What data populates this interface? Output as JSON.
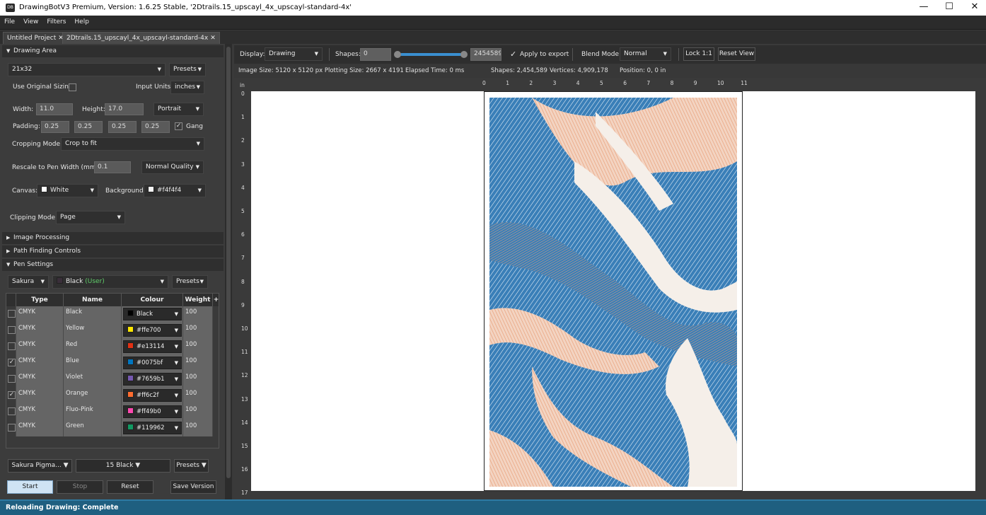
{
  "window": {
    "title": "DrawingBotV3 Premium, Version: 1.6.25 Stable, '2Dtrails.15_upscayl_4x_upscayl-standard-4x'",
    "app_icon_text": "DB",
    "minimize": "—",
    "maximize": "☐",
    "close": "✕"
  },
  "menu": [
    "File",
    "View",
    "Filters",
    "Help"
  ],
  "tabs": [
    {
      "label": "Untitled Project",
      "close": "✕"
    },
    {
      "label": "2Dtrails.15_upscayl_4x_upscayl-standard-4x",
      "close": "✕"
    }
  ],
  "drawing_area": {
    "header": "Drawing Area",
    "size_preset": "21x32",
    "presets_label": "Presets",
    "use_original_sizing_label": "Use Original Sizing",
    "input_units_label": "Input Units:",
    "input_units_value": "inches",
    "width_label": "Width:",
    "width_value": "11.0",
    "height_label": "Height:",
    "height_value": "17.0",
    "orientation": "Portrait",
    "padding_label": "Padding:",
    "padding_values": [
      "0.25",
      "0.25",
      "0.25",
      "0.25"
    ],
    "gang_label": "Gang",
    "gang_checked": "✓",
    "cropping_label": "Cropping Mode:",
    "cropping_value": "Crop to fit",
    "rescale_label": "Rescale to Pen Width (mm):",
    "rescale_value": "0.1",
    "quality_value": "Normal Quality",
    "canvas_label": "Canvas:",
    "canvas_value": "White",
    "canvas_color": "#ffffff",
    "background_label": "Background:",
    "background_value": "#f4f4f4",
    "background_color": "#f4f4f4",
    "clipping_label": "Clipping Mode:",
    "clipping_value": "Page"
  },
  "sections": {
    "image_processing": "Image Processing",
    "path_finding": "Path Finding Controls",
    "pen_settings": "Pen Settings"
  },
  "pen_settings": {
    "brand": "Sakura",
    "pen": "Black",
    "pen_suffix": "(User)",
    "presets_label": "Presets",
    "columns": [
      "Type",
      "Name",
      "Colour",
      "Weight"
    ],
    "add_symbol": "+",
    "rows": [
      {
        "checked": "",
        "type": "CMYK",
        "name": "Black",
        "colour": "Black",
        "color_hex": "#000000",
        "weight": "100"
      },
      {
        "checked": "",
        "type": "CMYK",
        "name": "Yellow",
        "colour": "#ffe700",
        "color_hex": "#ffe700",
        "weight": "100"
      },
      {
        "checked": "",
        "type": "CMYK",
        "name": "Red",
        "colour": "#e13114",
        "color_hex": "#e13114",
        "weight": "100"
      },
      {
        "checked": "✓",
        "type": "CMYK",
        "name": "Blue",
        "colour": "#0075bf",
        "color_hex": "#0075bf",
        "weight": "100"
      },
      {
        "checked": "",
        "type": "CMYK",
        "name": "Violet",
        "colour": "#7659b1",
        "color_hex": "#7659b1",
        "weight": "100"
      },
      {
        "checked": "✓",
        "type": "CMYK",
        "name": "Orange",
        "colour": "#ff6c2f",
        "color_hex": "#ff6c2f",
        "weight": "100"
      },
      {
        "checked": "",
        "type": "CMYK",
        "name": "Fluo-Pink",
        "colour": "#ff49b0",
        "color_hex": "#ff49b0",
        "weight": "100"
      },
      {
        "checked": "",
        "type": "CMYK",
        "name": "Green",
        "colour": "#119962",
        "color_hex": "#119962",
        "weight": "100"
      }
    ],
    "set_brand": "Sakura Pigma...",
    "set_name": "15 Black",
    "set_presets_label": "Presets"
  },
  "bottom_buttons": {
    "start": "Start",
    "stop": "Stop",
    "reset": "Reset",
    "save_version": "Save Version"
  },
  "toolbar": {
    "display_label": "Display:",
    "display_value": "Drawing",
    "shapes_label": "Shapes:",
    "shapes_min": "0",
    "shapes_max": "2454589",
    "apply_export_label": "Apply to export",
    "apply_export_check": "✓",
    "blend_label": "Blend Mode:",
    "blend_value": "Normal",
    "lock_label": "Lock 1:1",
    "reset_view_label": "Reset View",
    "slider_level": 1.0
  },
  "info": {
    "image_size": "Image Size: 5120 x 5120 px  Plotting Size: 2667 x 4191",
    "elapsed": "Elapsed Time: 0 ms",
    "shapes": "Shapes: 2,454,589",
    "vertices": "Vertices: 4,909,178",
    "position": "Position: 0, 0 in"
  },
  "ruler": {
    "unit": "in",
    "top_ticks": [
      "0",
      "1",
      "2",
      "3",
      "4",
      "5",
      "6",
      "7",
      "8",
      "9",
      "10",
      "11"
    ],
    "left_ticks": [
      "0",
      "1",
      "2",
      "3",
      "4",
      "5",
      "6",
      "7",
      "8",
      "9",
      "10",
      "11",
      "12",
      "13",
      "14",
      "15",
      "16",
      "17"
    ]
  },
  "status": "Reloading Drawing: Complete",
  "colors": {
    "art_blue": "#3a7fb8",
    "art_orange": "#e8a07a",
    "accent": "#1f5f80"
  }
}
